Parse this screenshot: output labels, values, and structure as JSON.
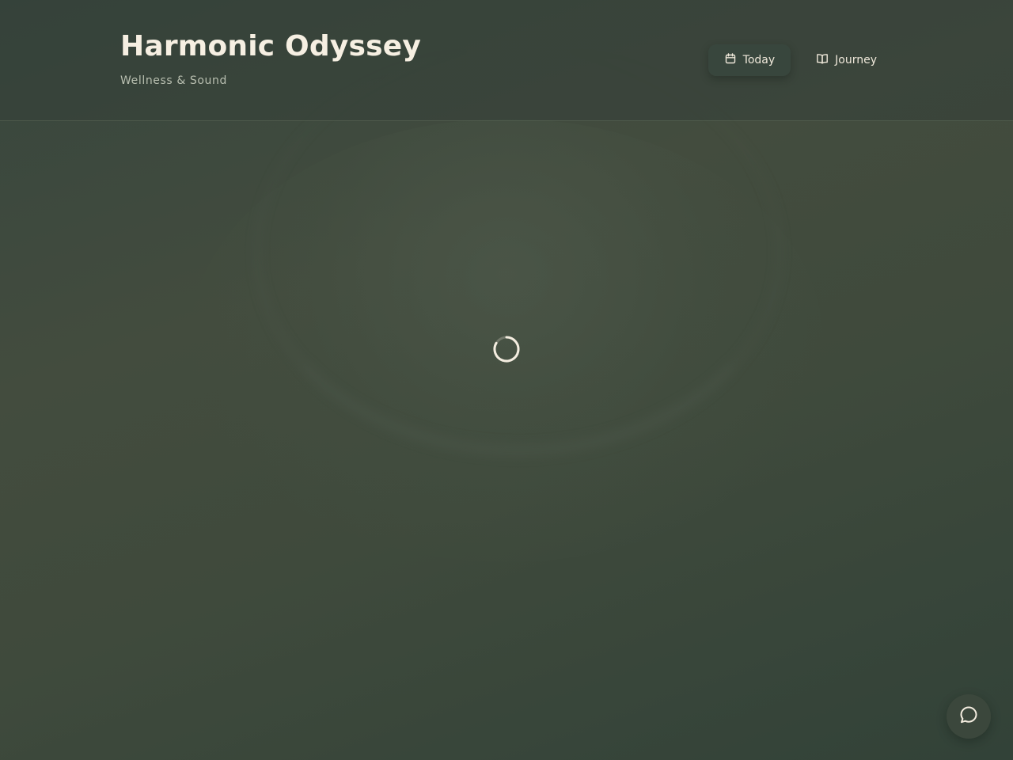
{
  "header": {
    "title": "Harmonic Odyssey",
    "subtitle": "Wellness & Sound"
  },
  "nav": {
    "items": [
      {
        "label": "Today",
        "icon": "calendar-icon",
        "active": true
      },
      {
        "label": "Journey",
        "icon": "book-open-icon",
        "active": false
      }
    ]
  },
  "main": {
    "state": "loading",
    "loader_icon": "spinner-icon"
  },
  "chat": {
    "icon": "chat-bubble-icon"
  },
  "colors": {
    "background": "#3f4a3c",
    "title": "#f6efe2",
    "subtitle": "#b9bfb0",
    "active_tab": "#38463e"
  }
}
